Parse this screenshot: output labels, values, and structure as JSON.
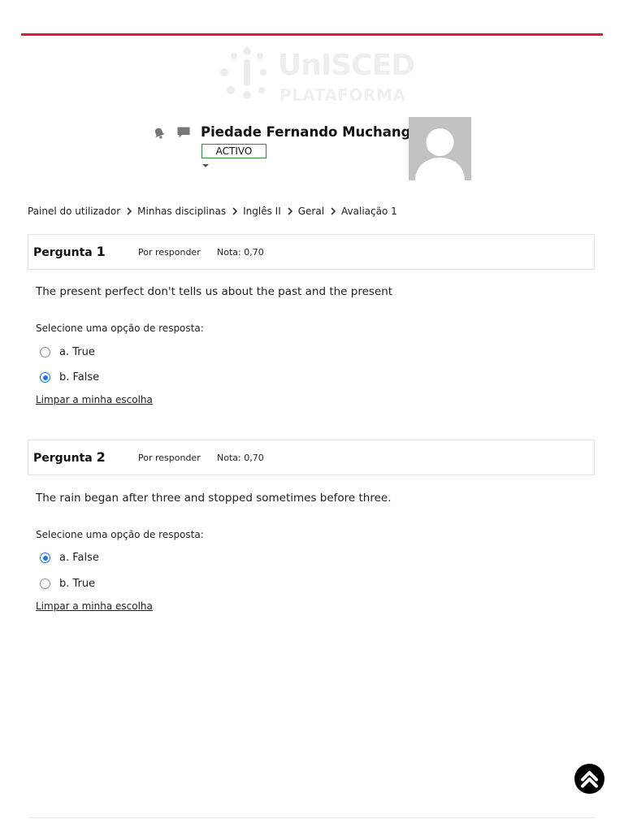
{
  "colors": {
    "accent": "#d61f35",
    "status_border": "#2b8a3e",
    "radio_selected": "#1a73e8"
  },
  "logo": {
    "brand": "UnISCED",
    "sub": "PLATAFORMA"
  },
  "header": {
    "icons": [
      "bell-icon",
      "chat-icon"
    ],
    "user_name": "Piedade Fernando Muchanga",
    "status": "ACTIVO"
  },
  "breadcrumb": [
    "Painel do utilizador",
    "Minhas disciplinas",
    "Inglês II",
    "Geral",
    "Avaliação 1"
  ],
  "questions": [
    {
      "label": "Pergunta",
      "number": "1",
      "state": "Por responder",
      "grade": "Nota: 0,70",
      "text": "The present perfect don't tells us about the past and the present",
      "prompt": "Selecione uma opção de resposta:",
      "options": [
        {
          "label": "a. True",
          "selected": false
        },
        {
          "label": "b. False",
          "selected": true
        }
      ],
      "clear": "Limpar a minha escolha"
    },
    {
      "label": "Pergunta",
      "number": "2",
      "state": "Por responder",
      "grade": "Nota: 0,70",
      "text": "The rain began after three and stopped sometimes before three.",
      "prompt": "Selecione uma opção de resposta:",
      "options": [
        {
          "label": "a. False",
          "selected": true
        },
        {
          "label": "b. True",
          "selected": false
        }
      ],
      "clear": "Limpar a minha escolha"
    }
  ],
  "back_to_top_icon": "chevron-up-icon"
}
